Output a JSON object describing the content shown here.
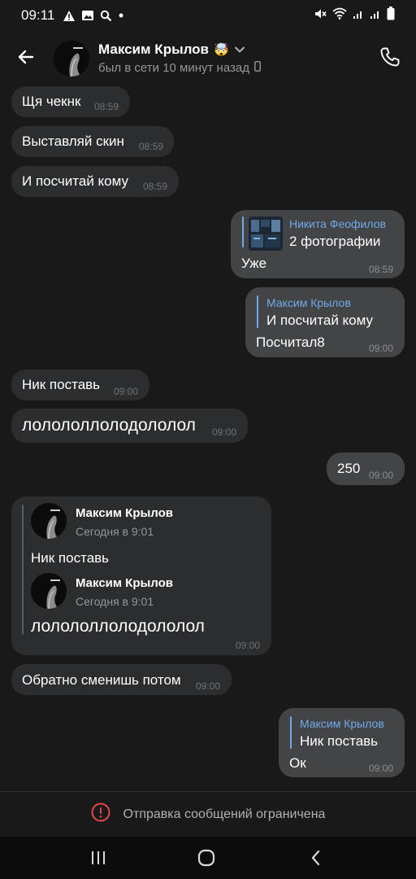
{
  "status_bar": {
    "time": "09:11"
  },
  "header": {
    "contact_name": "Максим Крылов",
    "contact_emoji": "🤯",
    "status_text": "был в сети 10 минут назад"
  },
  "messages": [
    {
      "text": "Щя чекнк",
      "time": "08:59",
      "direction": "in"
    },
    {
      "text": "Выставляй скин",
      "time": "08:59",
      "direction": "in"
    },
    {
      "text": "И посчитай кому",
      "time": "08:59",
      "direction": "in"
    },
    {
      "reply_name": "Никита Феофилов",
      "reply_text": "2 фотографии",
      "text": "Уже",
      "time": "08:59",
      "direction": "out"
    },
    {
      "reply_name": "Максим Крылов",
      "reply_text": "И посчитай кому",
      "text": "Посчитал8",
      "time": "09:00",
      "direction": "out"
    },
    {
      "text": "Ник поставь",
      "time": "09:00",
      "direction": "in"
    },
    {
      "text": "лолололлолодололол",
      "time": "09:00",
      "direction": "in"
    },
    {
      "text": "250",
      "time": "09:00",
      "direction": "out"
    },
    {
      "direction": "in",
      "time": "09:00",
      "forwarded": [
        {
          "name": "Максим Крылов",
          "date": "Сегодня в 9:01",
          "text": "Ник поставь"
        },
        {
          "name": "Максим Крылов",
          "date": "Сегодня в 9:01",
          "text": "лолололлолодололол"
        }
      ]
    },
    {
      "text": "Обратно сменишь потом",
      "time": "09:00",
      "direction": "in"
    },
    {
      "reply_name": "Максим Крылов",
      "reply_text": "Ник поставь",
      "text": "Ок",
      "time": "09:00",
      "direction": "out"
    }
  ],
  "footer": {
    "restricted_text": "Отправка сообщений ограничена"
  },
  "colors": {
    "accent": "#71aaeb",
    "warning": "#e64646",
    "incoming_bubble": "#2c2d2e",
    "outgoing_bubble": "#434446"
  }
}
